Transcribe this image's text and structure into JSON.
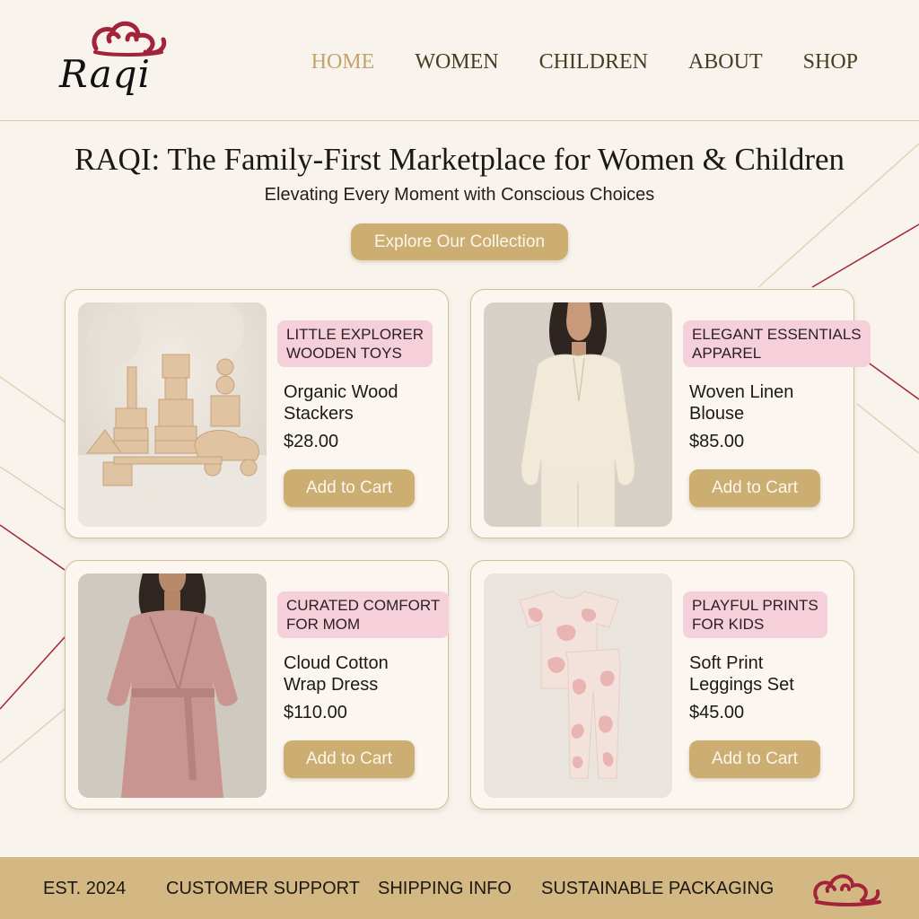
{
  "brand": {
    "name": "Raqi",
    "accent_color": "#a3243a",
    "gold": "#ccae73",
    "tag_pink": "#f5cfd9"
  },
  "nav": {
    "items": [
      {
        "label": "HOME",
        "active": true
      },
      {
        "label": "WOMEN",
        "active": false
      },
      {
        "label": "CHILDREN",
        "active": false
      },
      {
        "label": "ABOUT",
        "active": false
      },
      {
        "label": "SHOP",
        "active": false
      }
    ]
  },
  "hero": {
    "title": "RAQI: The Family-First Marketplace for Women & Children",
    "subtitle": "Elevating Every Moment with Conscious Choices",
    "cta": "Explore Our Collection"
  },
  "products": [
    {
      "tag_line1": "LITTLE EXPLORER",
      "tag_line2": "WOODEN TOYS",
      "name_line1": "Organic Wood",
      "name_line2": "Stackers",
      "price": "$28.00",
      "button": "Add to Cart",
      "image_icon": "wooden-toys-image"
    },
    {
      "tag_line1": "ELEGANT ESSENTIALS",
      "tag_line2": "APPAREL",
      "name_line1": "Woven Linen",
      "name_line2": "Blouse",
      "price": "$85.00",
      "button": "Add to Cart",
      "image_icon": "linen-blouse-image"
    },
    {
      "tag_line1": "CURATED COMFORT",
      "tag_line2": "FOR MOM",
      "name_line1": "Cloud Cotton",
      "name_line2": "Wrap Dress",
      "price": "$110.00",
      "button": "Add to Cart",
      "image_icon": "wrap-dress-image"
    },
    {
      "tag_line1": "PLAYFUL PRINTS",
      "tag_line2": "FOR KIDS",
      "name_line1": "Soft Print",
      "name_line2": "Leggings Set",
      "price": "$45.00",
      "button": "Add to Cart",
      "image_icon": "kids-print-set-image"
    }
  ],
  "footer": {
    "items": [
      "EST. 2024",
      "CUSTOMER SUPPORT",
      "SHIPPING INFO",
      "SUSTAINABLE PACKAGING"
    ]
  }
}
